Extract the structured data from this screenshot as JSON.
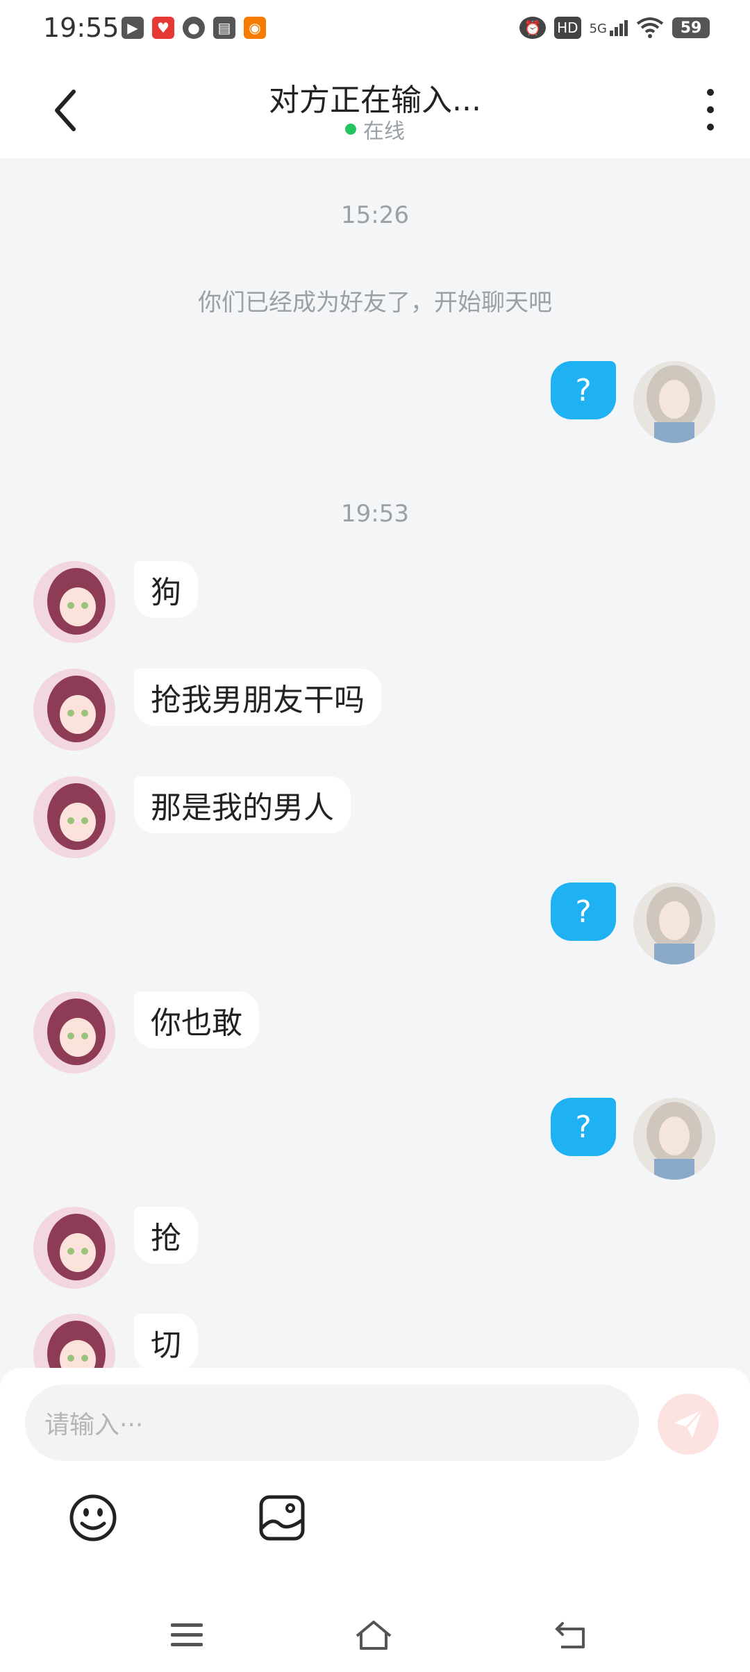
{
  "status_bar": {
    "time": "19:55",
    "network": "5G",
    "hd": "HD",
    "battery": "59"
  },
  "header": {
    "title": "对方正在输入...",
    "status": "在线"
  },
  "chat": {
    "times": [
      "15:26",
      "19:53"
    ],
    "system_message": "你们已经成为好友了，开始聊天吧",
    "messages": [
      {
        "side": "right",
        "text": "?"
      },
      {
        "side": "left",
        "text": "狗"
      },
      {
        "side": "left",
        "text": "抢我男朋友干吗"
      },
      {
        "side": "left",
        "text": "那是我的男人"
      },
      {
        "side": "right",
        "text": "?"
      },
      {
        "side": "left",
        "text": "你也敢"
      },
      {
        "side": "right",
        "text": "?"
      },
      {
        "side": "left",
        "text": "抢"
      },
      {
        "side": "left",
        "text": "切"
      }
    ]
  },
  "composer": {
    "placeholder": "请输入···"
  },
  "colors": {
    "bubble_right": "#1fb2f2",
    "bubble_left": "#ffffff",
    "background": "#f4f5f7",
    "online_dot": "#22c55e",
    "send_button": "#fde2e2"
  },
  "icons": {
    "back": "chevron-left-icon",
    "more": "more-vertical-icon",
    "emoji": "smiley-icon",
    "image": "image-icon",
    "send": "paper-plane-icon"
  }
}
